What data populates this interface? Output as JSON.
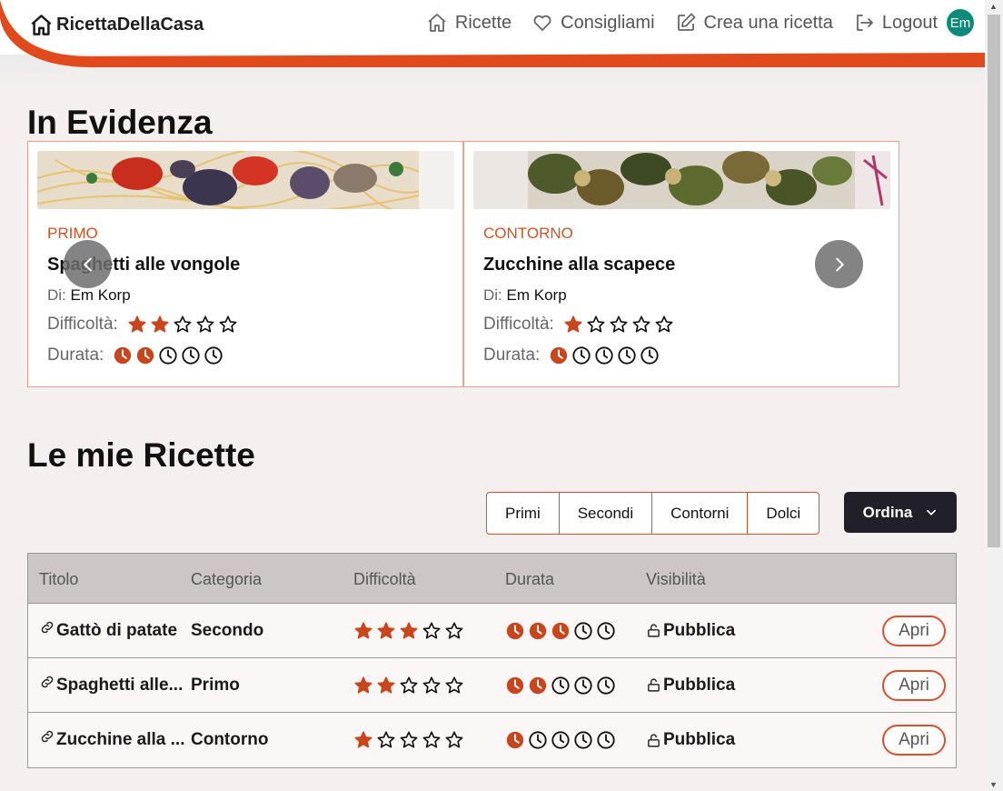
{
  "brand": {
    "name": "RicettaDellaCasa",
    "accent": "#e04a1c"
  },
  "nav": {
    "items": [
      {
        "label": "Ricette",
        "icon": "home-icon"
      },
      {
        "label": "Consigliami",
        "icon": "heart-icon"
      },
      {
        "label": "Crea una ricetta",
        "icon": "edit-icon"
      },
      {
        "label": "Logout",
        "icon": "logout-icon"
      }
    ],
    "avatar": "Em"
  },
  "featured": {
    "title": "In Evidenza",
    "difficulty_label": "Difficoltà:",
    "duration_label": "Durata:",
    "author_prefix": "Di:",
    "cards": [
      {
        "category": "PRIMO",
        "title": "Spaghetti alle vongole",
        "author": "Em Korp",
        "difficulty": 2,
        "duration": 2
      },
      {
        "category": "CONTORNO",
        "title": "Zucchine alla scapece",
        "author": "Em Korp",
        "difficulty": 1,
        "duration": 1
      }
    ]
  },
  "my_recipes": {
    "title": "Le mie Ricette",
    "filters": [
      "Primi",
      "Secondi",
      "Contorni",
      "Dolci"
    ],
    "sort_label": "Ordina",
    "columns": [
      "Titolo",
      "Categoria",
      "Difficoltà",
      "Durata",
      "Visibilità"
    ],
    "open_label": "Apri",
    "rows": [
      {
        "title": "Gattò di patate",
        "category": "Secondo",
        "difficulty": 3,
        "duration": 3,
        "visibility": "Pubblica"
      },
      {
        "title": "Spaghetti alle...",
        "category": "Primo",
        "difficulty": 2,
        "duration": 2,
        "visibility": "Pubblica"
      },
      {
        "title": "Zucchine alla ...",
        "category": "Contorno",
        "difficulty": 1,
        "duration": 1,
        "visibility": "Pubblica"
      }
    ]
  },
  "colors": {
    "star": "#c9461c",
    "clock": "#c9461c",
    "avatar": "#0e8a78",
    "dark_button": "#212029"
  }
}
